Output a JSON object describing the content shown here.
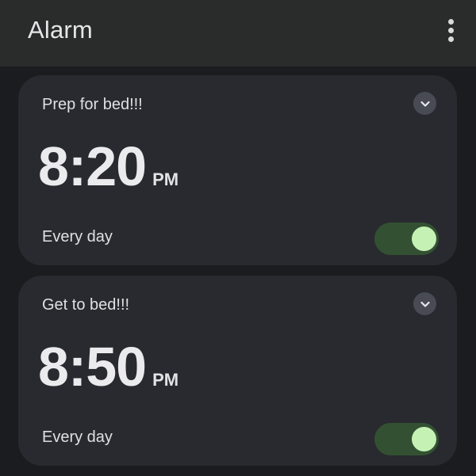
{
  "app_bar": {
    "title": "Alarm",
    "overflow_icon": "more-vert-icon"
  },
  "alarms": [
    {
      "label": "Prep for bed!!!",
      "time": "8:20",
      "ampm": "PM",
      "repeat": "Every day",
      "enabled": true,
      "expand_icon": "chevron-down-icon"
    },
    {
      "label": "Get to bed!!!",
      "time": "8:50",
      "ampm": "PM",
      "repeat": "Every day",
      "enabled": true,
      "expand_icon": "chevron-down-icon"
    }
  ],
  "colors": {
    "background": "#1b1c1f",
    "app_bar": "#2a2c2b",
    "card": "#282a2f",
    "toggle_on_track": "#335132",
    "toggle_on_thumb": "#c5f1b4",
    "expand_button": "#484a54"
  }
}
